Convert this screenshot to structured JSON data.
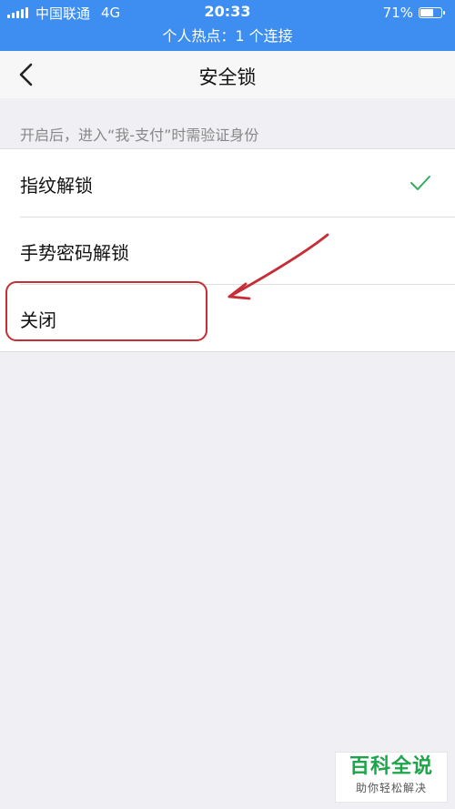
{
  "status_bar": {
    "carrier": "中国联通",
    "network": "4G",
    "time": "20:33",
    "battery_percent": "71%",
    "battery_level": 0.71,
    "hotspot_text": "个人热点：1 个连接",
    "background_color": "#3d8ef0"
  },
  "nav": {
    "back_icon": "chevron-left-icon",
    "title": "安全锁"
  },
  "section": {
    "header": "开启后，进入“我-支付”时需验证身份"
  },
  "options": [
    {
      "label": "指纹解锁",
      "selected": true
    },
    {
      "label": "手势密码解锁",
      "selected": false
    },
    {
      "label": "关闭",
      "selected": false
    }
  ],
  "check_icon": "checkmark-icon",
  "check_color": "#2fae5f",
  "annotation_color": "#c62d34",
  "watermark": {
    "title": "百科全说",
    "subtitle": "助你轻松解决",
    "color": "#1da54a"
  }
}
